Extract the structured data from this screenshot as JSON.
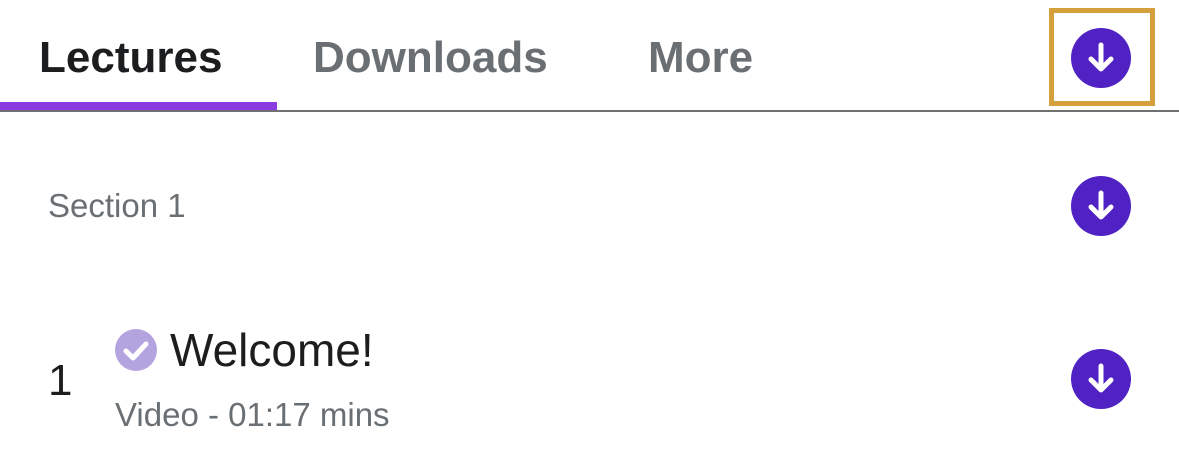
{
  "tabs": [
    {
      "label": "Lectures",
      "active": true
    },
    {
      "label": "Downloads",
      "active": false
    },
    {
      "label": "More",
      "active": false
    }
  ],
  "colors": {
    "accent": "#8a3ce0",
    "download_button": "#5022c3",
    "highlight": "#d4a03c",
    "check": "#b3a4e0"
  },
  "icons": {
    "download": "download-arrow-icon",
    "completed": "check-circle-icon"
  },
  "section": {
    "title": "Section 1"
  },
  "lectures": [
    {
      "number": "1",
      "title": "Welcome!",
      "meta": "Video - 01:17 mins",
      "completed": true
    }
  ]
}
